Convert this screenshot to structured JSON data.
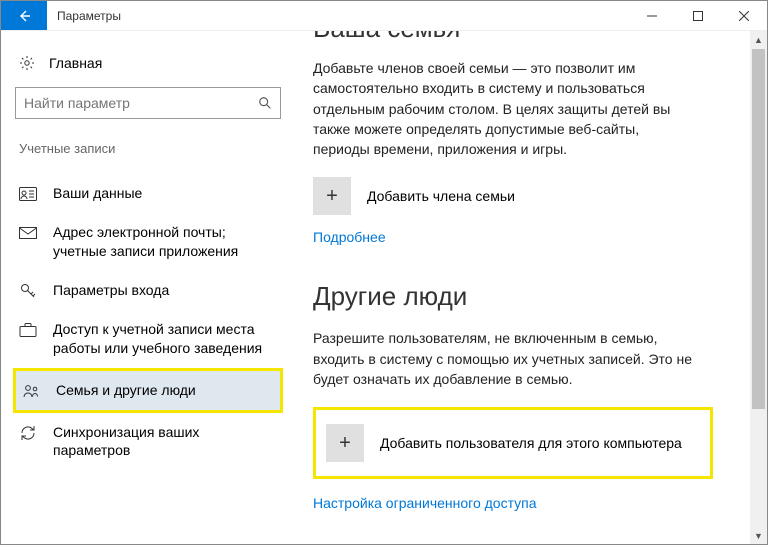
{
  "window": {
    "title": "Параметры",
    "back_icon": "arrow-left",
    "minimize": "—",
    "maximize": "▢",
    "close": "✕"
  },
  "sidebar": {
    "home_label": "Главная",
    "search_placeholder": "Найти параметр",
    "group_title": "Учетные записи",
    "items": [
      {
        "label": "Ваши данные"
      },
      {
        "label": "Адрес электронной почты; учетные записи приложения"
      },
      {
        "label": "Параметры входа"
      },
      {
        "label": "Доступ к учетной записи места работы или учебного заведения"
      },
      {
        "label": "Семья и другие люди"
      },
      {
        "label": "Синхронизация ваших параметров"
      }
    ]
  },
  "main": {
    "section1_heading": "Ваша семья",
    "section1_body": "Добавьте членов своей семьи — это позволит им самостоятельно входить в систему и пользоваться отдельным рабочим столом. В целях защиты детей вы также можете определять допустимые веб-сайты, периоды времени, приложения и игры.",
    "add_family_label": "Добавить члена семьи",
    "learn_more": "Подробнее",
    "section2_heading": "Другие люди",
    "section2_body": "Разрешите пользователям, не включенным в семью, входить в систему с помощью их учетных записей. Это не будет означать их добавление в семью.",
    "add_user_label": "Добавить пользователя для этого компьютера",
    "kiosk_link": "Настройка ограниченного доступа"
  }
}
